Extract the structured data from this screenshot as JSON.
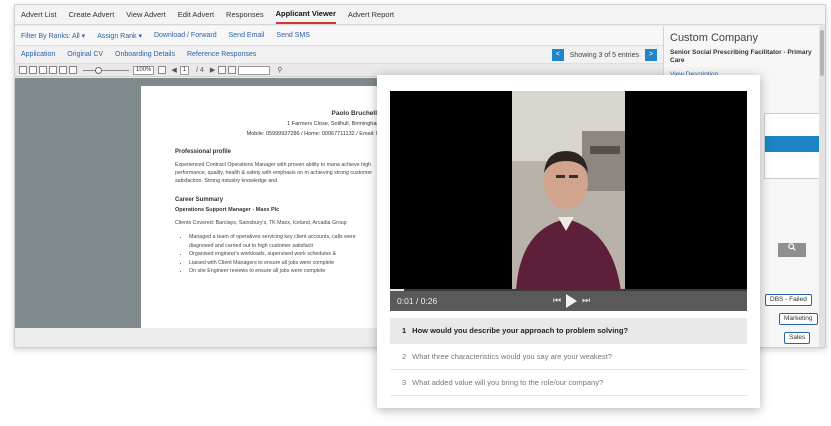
{
  "topnav": {
    "items": [
      "Advert List",
      "Create Advert",
      "View Advert",
      "Edit Advert",
      "Responses",
      "Applicant Viewer",
      "Advert Report"
    ],
    "active": "Applicant Viewer"
  },
  "toolbar1": {
    "filter_label": "Filter By Ranks: All ▾",
    "assign_label": "Assign Rank ▾",
    "download_label": "Download / Forward",
    "email_label": "Send Email",
    "sms_label": "Send SMS"
  },
  "toolbar2": {
    "tabs": [
      "Application",
      "Original CV",
      "Onboarding Details",
      "Reference Responses"
    ],
    "pager_prev": "<",
    "pager_text": "Showing 3 of 5 entries",
    "pager_next": ">"
  },
  "pdfbar": {
    "zoom": "100%",
    "page_value": "1",
    "page_total": "/ 4"
  },
  "document": {
    "name": "Paolo Bruchello",
    "address": "1 Farmers Close, Solihull, Birmingham",
    "contact": "Mobile: 05999937286 / Home: 00067711132 / Email: br",
    "profile_heading": "Professional profile",
    "profile_text": "Experienced Contract Operations Manager with proven ability to mana achieve high performance, quality, health & safety with emphasis on m achieving strong customer satisfaction. Strong industry knowledge and",
    "career_heading": "Career Summary",
    "career_role": "Operations Support Manager - Maxx Plc",
    "clients_label": "Clients Covered: Barclays, Sainsbury's, TK Maxx, Iceland, Arcadia Group",
    "bullets": [
      "Managed a team of operatives servicing key client accounts, calls were diagnosed and carried out to high customer satisfacti",
      "Organised engineer's workloads, supervised work schedules &",
      "Liaised with Client Managers to ensure all jobs were complete",
      "On site Engineer reviews to ensure all jobs were complete"
    ]
  },
  "sidebar": {
    "company": "Custom Company",
    "role": "Senior Social Prescribing Facilitator - Primary Care",
    "view_description": "View Description",
    "search_icon": "search-icon",
    "tags": [
      "DBS - Failed",
      "Marketing",
      "Sales"
    ]
  },
  "video": {
    "time": "0:01 / 0:26",
    "progress": 0.04
  },
  "questions": [
    {
      "num": "1",
      "text": "How would you describe your approach to problem solving?"
    },
    {
      "num": "2",
      "text": "What three characteristics would you say are your weakest?"
    },
    {
      "num": "3",
      "text": "What added value will you bring to the role/our company?"
    }
  ],
  "colors": {
    "accent": "#1f84c9",
    "active_underline": "#d63333",
    "link": "#2b62a8"
  }
}
